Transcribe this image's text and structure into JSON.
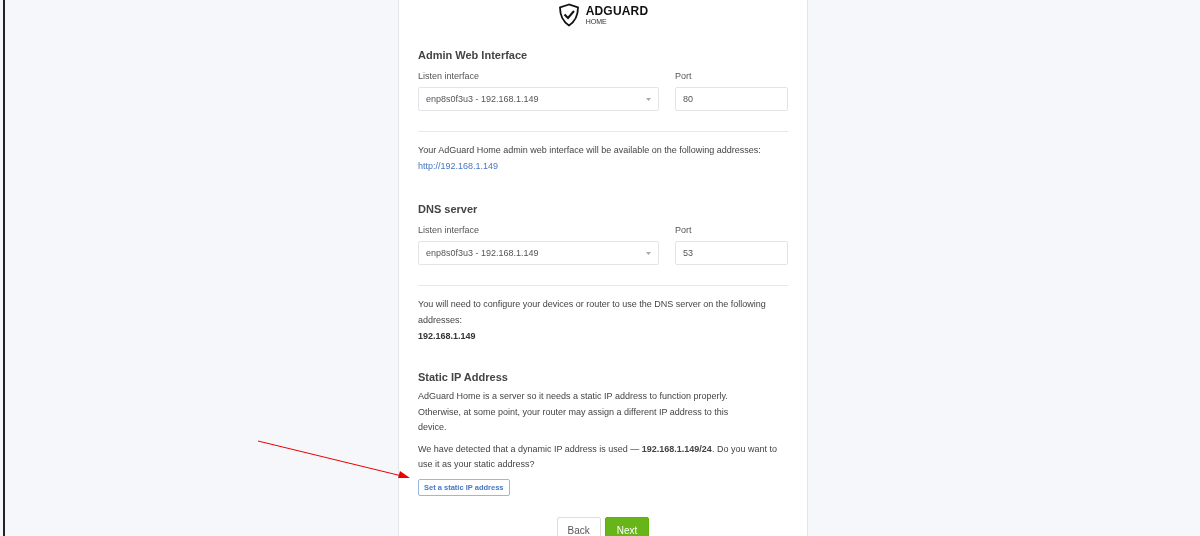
{
  "logo": {
    "name": "ADGUARD",
    "subtitle": "HOME"
  },
  "sections": [
    {
      "kind": "interface",
      "title": "Admin Web Interface",
      "interface_label": "Listen interface",
      "interface_value": "enp8s0f3u3 - 192.168.1.149",
      "port_label": "Port",
      "port_value": "80",
      "note": "Your AdGuard Home admin web interface will be available on the following addresses:",
      "address": {
        "kind": "link",
        "text": "http://192.168.1.149"
      }
    },
    {
      "kind": "interface",
      "title": "DNS server",
      "interface_label": "Listen interface",
      "interface_value": "enp8s0f3u3 - 192.168.1.149",
      "port_label": "Port",
      "port_value": "53",
      "note": "You will need to configure your devices or router to use the DNS server on the following addresses:",
      "address": {
        "kind": "plain",
        "text": "192.168.1.149"
      }
    },
    {
      "kind": "static",
      "title": "Static IP Address",
      "paragraphs": [
        "AdGuard Home is a server so it needs a static IP address to function properly. Otherwise, at some point, your router may assign a different IP address to this device.",
        "We have detected that a dynamic IP address is used — **192.168.1.149/24**. Do you want to use it as your static address?"
      ],
      "button": "Set a static IP address"
    }
  ],
  "buttons": [
    {
      "label": "Back",
      "kind": "secondary"
    },
    {
      "label": "Next",
      "kind": "primary"
    }
  ]
}
